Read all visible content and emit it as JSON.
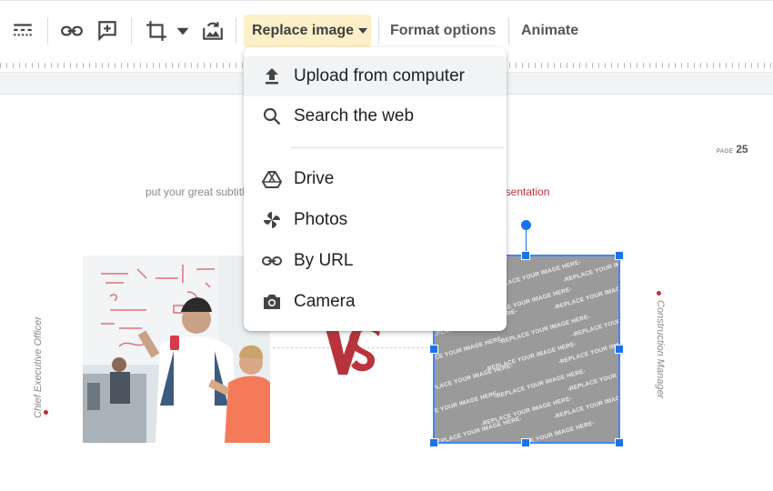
{
  "toolbar": {
    "replace_image_label": "Replace image",
    "format_options_label": "Format options",
    "animate_label": "Animate"
  },
  "dropdown": {
    "items": [
      {
        "label": "Upload from computer",
        "icon": "upload-icon"
      },
      {
        "label": "Search the web",
        "icon": "search-icon"
      },
      {
        "label": "Drive",
        "icon": "drive-icon"
      },
      {
        "label": "Photos",
        "icon": "photos-icon"
      },
      {
        "label": "By URL",
        "icon": "link-icon"
      },
      {
        "label": "Camera",
        "icon": "camera-icon"
      }
    ]
  },
  "slide": {
    "page_label": "PAGE",
    "page_number": "25",
    "subtitle_left": "put your great subtitl",
    "subtitle_right": "esentation",
    "left_vertical_text": "Chief Executive Officer",
    "right_vertical_text": "Construction Manager",
    "vs_text": "VS",
    "placeholder_text": "REPLACE YOUR IMAGE HERE"
  },
  "colors": {
    "accent_red": "#c0303a",
    "selection_blue": "#1a73e8",
    "replace_button_bg": "#fdf0c8"
  }
}
